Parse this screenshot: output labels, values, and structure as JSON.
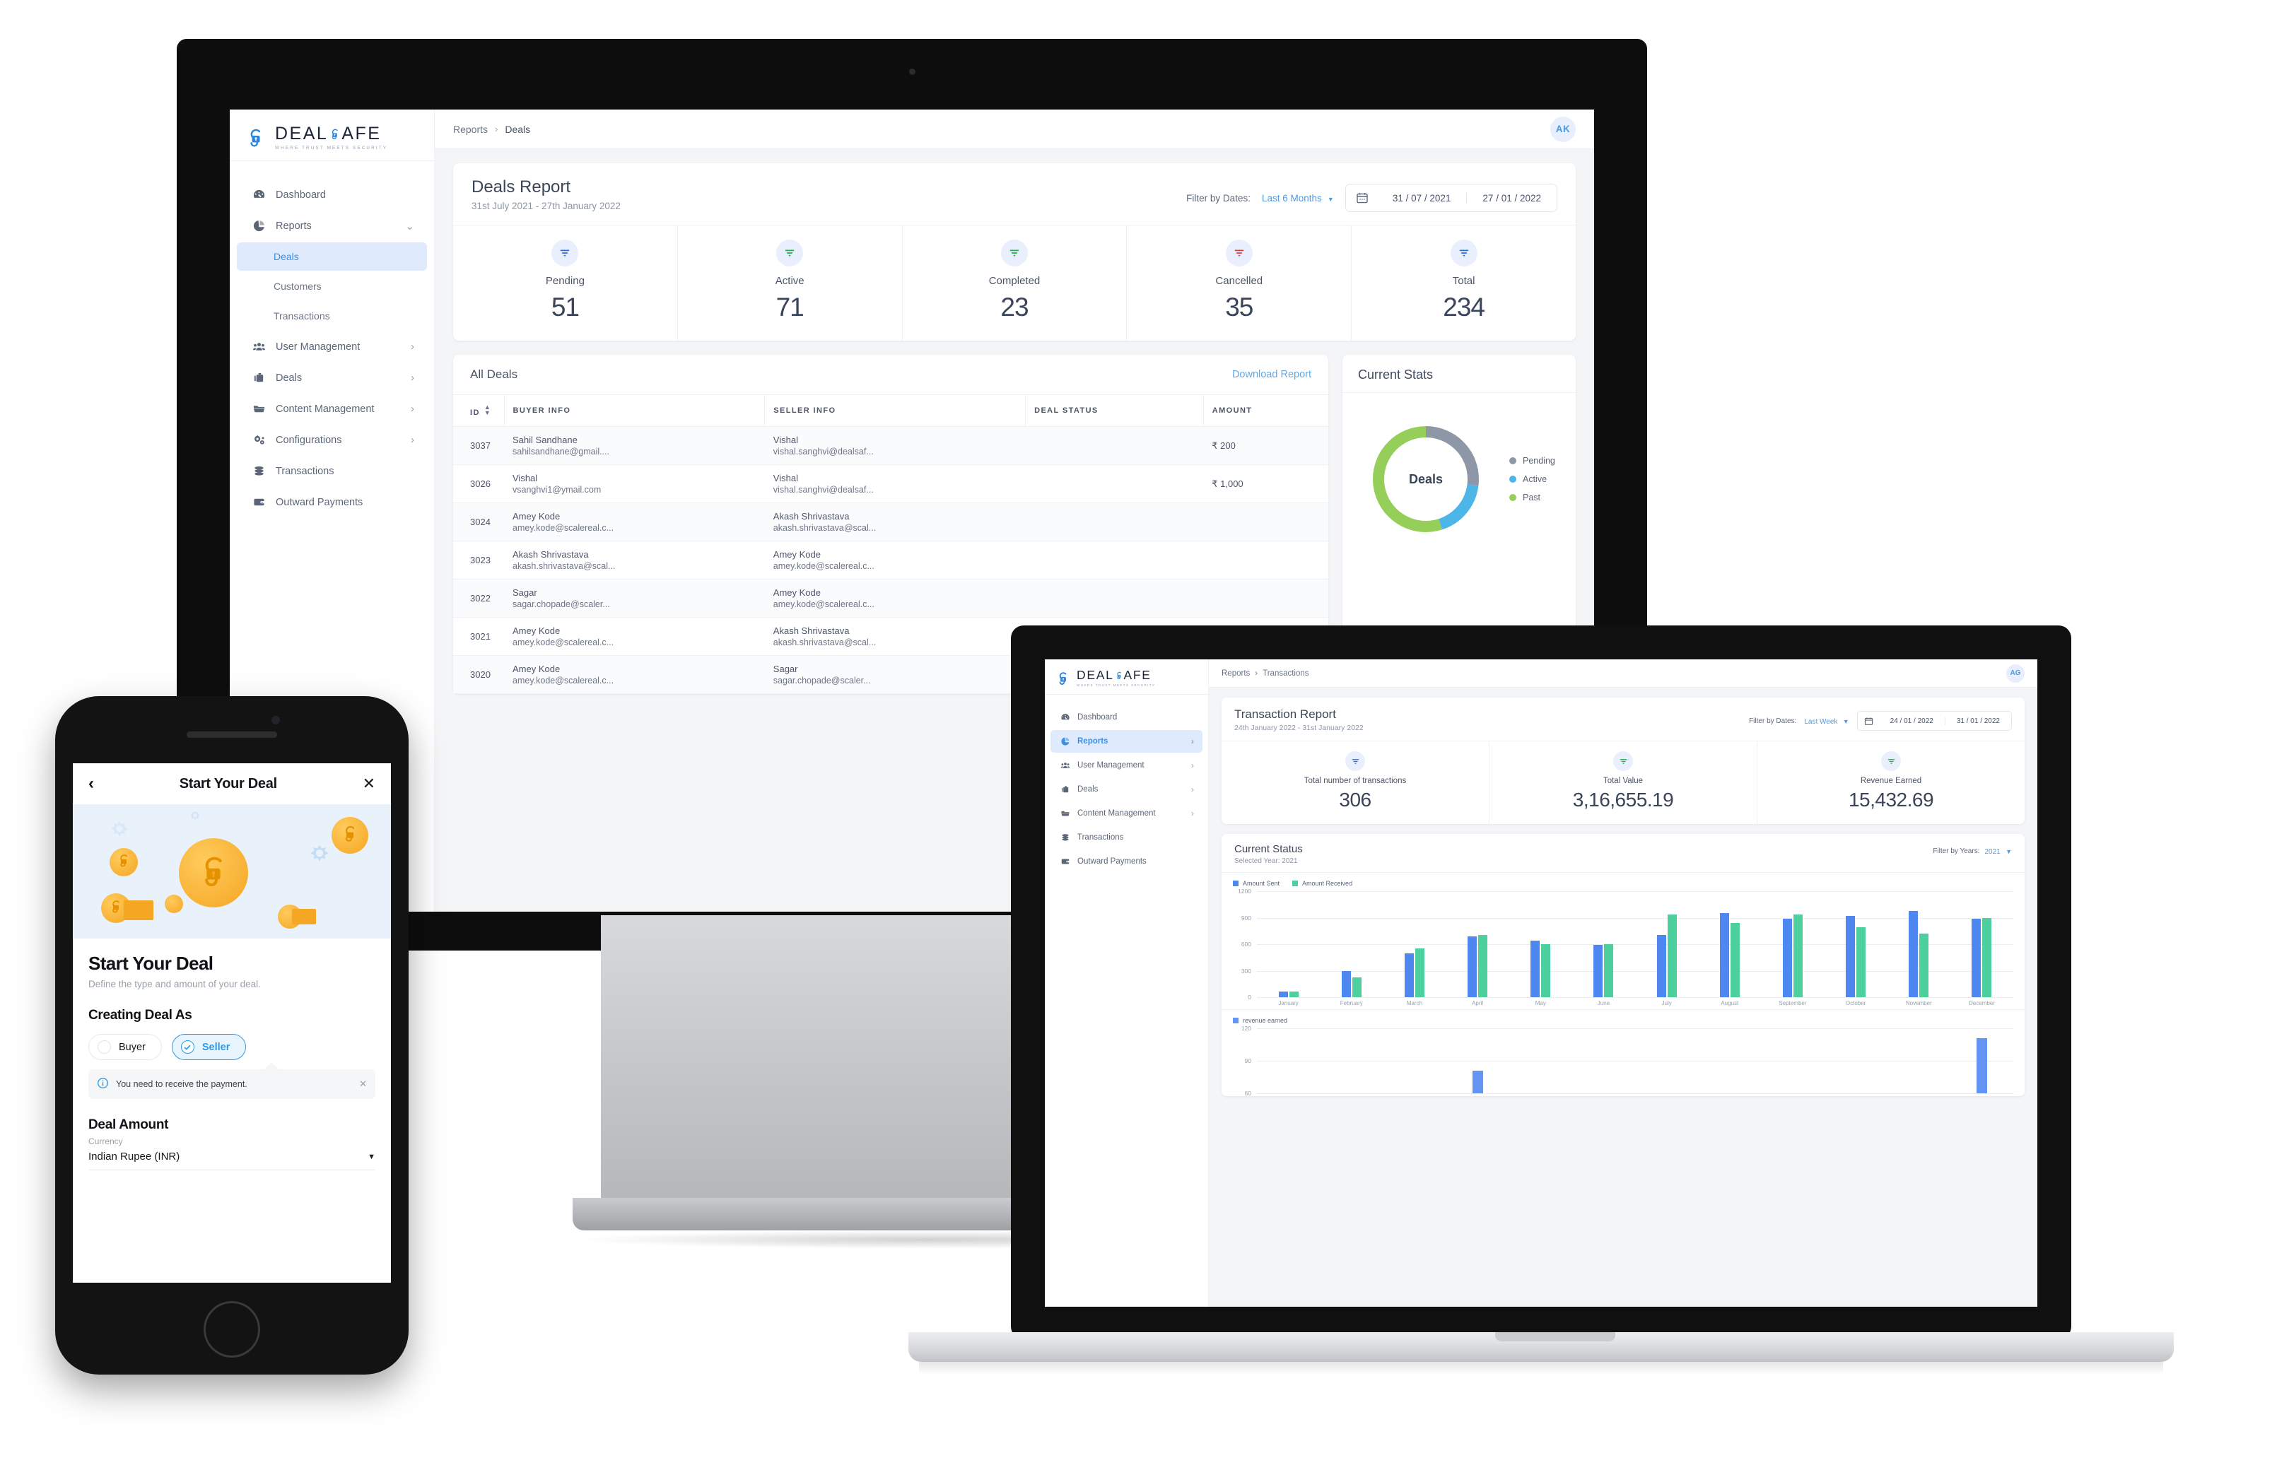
{
  "brand": {
    "name_part1": "DEAL",
    "name_part2": "AFE",
    "tagline": "WHERE TRUST MEETS SECURITY",
    "accent_blue": "#3d8fe0",
    "logo_blue": "#2b86d9"
  },
  "desktop": {
    "breadcrumb": {
      "parent": "Reports",
      "separator": "›",
      "current": "Deals"
    },
    "avatar": "AK",
    "sidebar": [
      {
        "label": "Dashboard",
        "icon": "dashboard-icon",
        "chevron": ""
      },
      {
        "label": "Reports",
        "icon": "pie-chart-icon",
        "chevron": "⌄"
      },
      {
        "label": "User Management",
        "icon": "users-icon",
        "chevron": "›"
      },
      {
        "label": "Deals",
        "icon": "briefcase-icon",
        "chevron": "›"
      },
      {
        "label": "Content Management",
        "icon": "folder-icon",
        "chevron": "›"
      },
      {
        "label": "Configurations",
        "icon": "gears-icon",
        "chevron": "›"
      },
      {
        "label": "Transactions",
        "icon": "coins-icon",
        "chevron": ""
      },
      {
        "label": "Outward Payments",
        "icon": "wallet-icon",
        "chevron": ""
      }
    ],
    "sub_items": [
      {
        "label": "Deals",
        "active": true
      },
      {
        "label": "Customers",
        "active": false
      },
      {
        "label": "Transactions",
        "active": false
      }
    ],
    "report": {
      "title": "Deals Report",
      "subtitle": "31st July 2021 - 27th January 2022",
      "filter_label": "Filter by Dates:",
      "filter_value": "Last 6 Months",
      "date_from": "31 / 07 / 2021",
      "date_to": "27 / 01 / 2022"
    },
    "stats": [
      {
        "label": "Pending",
        "value": "51",
        "color": "#2e6fd6"
      },
      {
        "label": "Active",
        "value": "71",
        "color": "#2aa84a"
      },
      {
        "label": "Completed",
        "value": "23",
        "color": "#2aa84a"
      },
      {
        "label": "Cancelled",
        "value": "35",
        "color": "#d94040"
      },
      {
        "label": "Total",
        "value": "234",
        "color": "#2e6fd6"
      }
    ],
    "table": {
      "title": "All Deals",
      "download_label": "Download Report",
      "columns": [
        "ID",
        "BUYER INFO",
        "SELLER INFO",
        "DEAL STATUS",
        "AMOUNT"
      ],
      "rows": [
        {
          "id": "3037",
          "buyer_name": "Sahil Sandhane",
          "buyer_mail": "sahilsandhane@gmail....",
          "seller_name": "Vishal",
          "seller_mail": "vishal.sanghvi@dealsaf...",
          "status": "",
          "amount": "₹ 200"
        },
        {
          "id": "3026",
          "buyer_name": "Vishal",
          "buyer_mail": "vsanghvi1@ymail.com",
          "seller_name": "Vishal",
          "seller_mail": "vishal.sanghvi@dealsaf...",
          "status": "",
          "amount": "₹ 1,000"
        },
        {
          "id": "3024",
          "buyer_name": "Amey Kode",
          "buyer_mail": "amey.kode@scalereal.c...",
          "seller_name": "Akash Shrivastava",
          "seller_mail": "akash.shrivastava@scal...",
          "status": "",
          "amount": ""
        },
        {
          "id": "3023",
          "buyer_name": "Akash Shrivastava",
          "buyer_mail": "akash.shrivastava@scal...",
          "seller_name": "Amey Kode",
          "seller_mail": "amey.kode@scalereal.c...",
          "status": "",
          "amount": ""
        },
        {
          "id": "3022",
          "buyer_name": "Sagar",
          "buyer_mail": "sagar.chopade@scaler...",
          "seller_name": "Amey Kode",
          "seller_mail": "amey.kode@scalereal.c...",
          "status": "",
          "amount": ""
        },
        {
          "id": "3021",
          "buyer_name": "Amey Kode",
          "buyer_mail": "amey.kode@scalereal.c...",
          "seller_name": "Akash Shrivastava",
          "seller_mail": "akash.shrivastava@scal...",
          "status": "",
          "amount": ""
        },
        {
          "id": "3020",
          "buyer_name": "Amey Kode",
          "buyer_mail": "amey.kode@scalereal.c...",
          "seller_name": "Sagar",
          "seller_mail": "sagar.chopade@scaler...",
          "status": "",
          "amount": ""
        }
      ]
    },
    "current_stats": {
      "title": "Current Stats",
      "center_label": "Deals"
    }
  },
  "laptop": {
    "breadcrumb": {
      "parent": "Reports",
      "separator": "›",
      "current": "Transactions"
    },
    "avatar": "AG",
    "sidebar": [
      {
        "label": "Dashboard",
        "icon": "dashboard-icon",
        "chevron": "",
        "active": false
      },
      {
        "label": "Reports",
        "icon": "pie-chart-icon",
        "chevron": "›",
        "active": true
      },
      {
        "label": "User Management",
        "icon": "users-icon",
        "chevron": "›",
        "active": false
      },
      {
        "label": "Deals",
        "icon": "briefcase-icon",
        "chevron": "›",
        "active": false
      },
      {
        "label": "Content Management",
        "icon": "folder-icon",
        "chevron": "›",
        "active": false
      },
      {
        "label": "Transactions",
        "icon": "coins-icon",
        "chevron": "",
        "active": false
      },
      {
        "label": "Outward Payments",
        "icon": "wallet-icon",
        "chevron": "",
        "active": false
      }
    ],
    "report": {
      "title": "Transaction Report",
      "subtitle": "24th January 2022 - 31st January 2022",
      "filter_label": "Filter by Dates:",
      "filter_value": "Last Week",
      "date_from": "24 / 01 / 2022",
      "date_to": "31 / 01 / 2022"
    },
    "stats": [
      {
        "label": "Total number of transactions",
        "value": "306",
        "color": "#2e6fd6"
      },
      {
        "label": "Total Value",
        "value": "3,16,655.19",
        "color": "#2aa84a"
      },
      {
        "label": "Revenue Earned",
        "value": "15,432.69",
        "color": "#2aa84a"
      }
    ],
    "current_status": {
      "title": "Current Status",
      "subtitle": "Selected Year: 2021",
      "filter_label": "Filter by Years:",
      "filter_value": "2021"
    }
  },
  "phone": {
    "header_title": "Start Your Deal",
    "back_icon": "chevron-left-icon",
    "close_icon": "close-icon",
    "heading": "Start Your Deal",
    "subheading": "Define the type and amount of your deal.",
    "section_label": "Creating Deal As",
    "options": [
      {
        "label": "Buyer",
        "selected": false
      },
      {
        "label": "Seller",
        "selected": true
      }
    ],
    "note": "You need to receive the payment.",
    "amount_label": "Deal Amount",
    "currency_label": "Currency",
    "currency_value": "Indian Rupee (INR)"
  },
  "chart_data": [
    {
      "type": "pie",
      "title": "Current Stats",
      "center_label": "Deals",
      "labels": [
        "Pending",
        "Active",
        "Past"
      ],
      "values": [
        27,
        18,
        55
      ],
      "colors": [
        "#8d97a8",
        "#4cb6e8",
        "#96ce5a"
      ],
      "legend": "right",
      "donut": true
    },
    {
      "type": "bar",
      "title": "Current Status",
      "subtitle": "Selected Year: 2021",
      "categories": [
        "January",
        "February",
        "March",
        "April",
        "May",
        "June",
        "July",
        "August",
        "September",
        "October",
        "November",
        "December"
      ],
      "series": [
        {
          "name": "Amount Sent",
          "color": "#4f87f0",
          "values": [
            65,
            298,
            500,
            690,
            640,
            590,
            705,
            955,
            890,
            920,
            980,
            890
          ]
        },
        {
          "name": "Amount Received",
          "color": "#4ecf9e",
          "values": [
            65,
            225,
            550,
            705,
            600,
            602,
            940,
            840,
            935,
            790,
            720,
            895
          ]
        }
      ],
      "ylim": [
        0,
        1200
      ],
      "yticks": [
        0,
        300,
        600,
        900,
        1200
      ],
      "ylabel": "",
      "xlabel": "",
      "grid": true,
      "legend": "top-left"
    },
    {
      "type": "bar",
      "title": "revenue earned",
      "categories": [
        "",
        "",
        "",
        "",
        "",
        "",
        "",
        "",
        "",
        "",
        "",
        ""
      ],
      "series": [
        {
          "name": "revenue earned",
          "color": "#6495f5",
          "values": [
            0,
            0,
            0,
            81,
            0,
            0,
            0,
            0,
            0,
            0,
            0,
            111
          ]
        }
      ],
      "ylim": [
        60,
        120
      ],
      "yticks": [
        60,
        90,
        120
      ],
      "grid": true,
      "legend": "top-left"
    }
  ]
}
